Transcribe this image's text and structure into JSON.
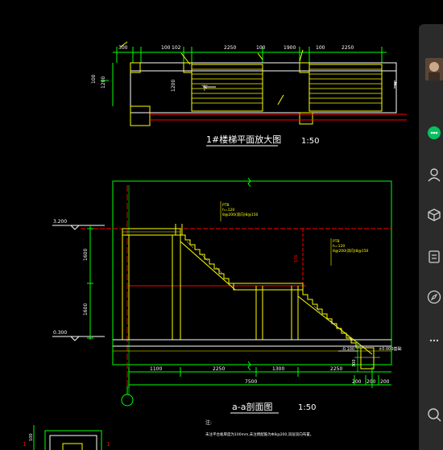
{
  "plan": {
    "title": "1#楼梯平面放大图",
    "scale": "1:50",
    "top_dims": [
      "300",
      "100",
      "102",
      "2250",
      "100",
      "1900",
      "100",
      "2250"
    ],
    "side_dims": [
      "1200",
      "1200",
      "100"
    ],
    "marks": [
      "下"
    ]
  },
  "section": {
    "title": "a-a剖面图",
    "scale": "1:50",
    "elev_top": "3.200",
    "elev_bottom": "0.300",
    "left_dims": [
      "1600",
      "1600"
    ],
    "mid_dim": "576",
    "bottom_dims": [
      "1100",
      "2250",
      "1300",
      "2250",
      "7500"
    ],
    "right_dims": [
      "-0.100",
      "200",
      "200",
      "200",
      "300"
    ],
    "right_note": "±0.000基础",
    "note_blocks": [
      [
        "PTB",
        "h=120",
        "8@200(双向)8@150"
      ],
      [
        "PTB",
        "h=120",
        "8@200(双向)8@150"
      ]
    ],
    "notes_label": "注:",
    "notes_text": "未注平台板厚度为100mm,未注明配筋为Φ8@200,双层双向布置。"
  },
  "detail": {
    "left_dim": "100",
    "right_dim": "1"
  },
  "sidebar": {
    "icons": [
      "user-icon",
      "chat-icon",
      "contacts-icon",
      "cube-icon",
      "document-icon",
      "compass-icon",
      "more-icon",
      "search-icon"
    ]
  },
  "colors": {
    "background": "#000000",
    "yellow": "#ffff00",
    "green": "#00ff00",
    "red": "#ff0000",
    "white": "#ffffff",
    "sidebar": "#2b2b2b"
  }
}
